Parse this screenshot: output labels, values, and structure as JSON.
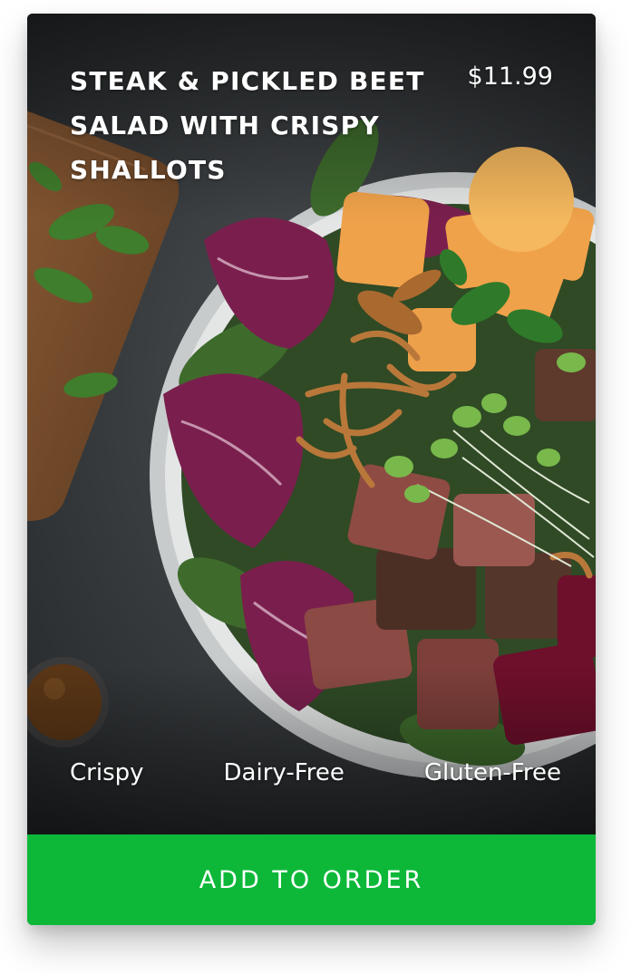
{
  "item": {
    "title": "STEAK & PICKLED BEET SALAD WITH CRISPY SHALLOTS",
    "price": "$11.99",
    "tags": [
      "Crispy",
      "Dairy-Free",
      "Gluten-Free"
    ],
    "photo": "salad-bowl-photo"
  },
  "actions": {
    "add_label": "ADD TO ORDER"
  },
  "colors": {
    "button": "#0db839",
    "background": "#2b2e30",
    "text": "#ffffff"
  }
}
